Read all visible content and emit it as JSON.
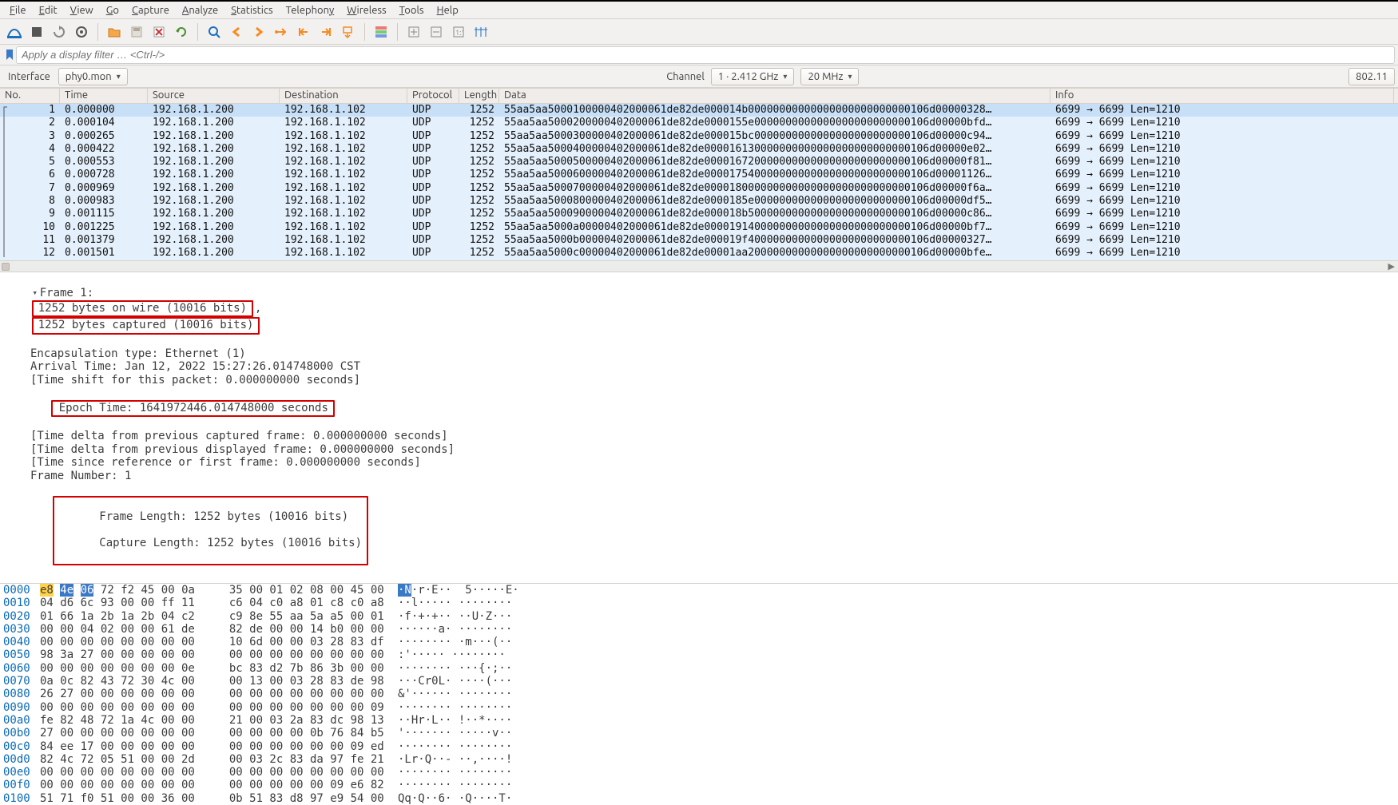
{
  "menu": {
    "items": [
      {
        "l": "F",
        "r": "ile"
      },
      {
        "l": "E",
        "r": "dit"
      },
      {
        "l": "V",
        "r": "iew"
      },
      {
        "l": "G",
        "r": "o"
      },
      {
        "l": "C",
        "r": "apture"
      },
      {
        "l": "A",
        "r": "nalyze"
      },
      {
        "l": "S",
        "r": "tatistics"
      },
      {
        "l": "",
        "r": "Telephon",
        "l2": "y"
      },
      {
        "l": "W",
        "r": "ireless"
      },
      {
        "l": "T",
        "r": "ools"
      },
      {
        "l": "H",
        "r": "elp"
      }
    ]
  },
  "filter": {
    "placeholder": "Apply a display filter … <Ctrl-/>"
  },
  "iface": {
    "label": "Interface",
    "value": "phy0.mon",
    "channel_label": "Channel",
    "channel_value": "1 · 2.412 GHz",
    "bw_value": "20 MHz",
    "std": "802.11"
  },
  "columns": [
    "No.",
    "Time",
    "Source",
    "Destination",
    "Protocol",
    "Length",
    "Data",
    "Info"
  ],
  "packets": [
    {
      "no": "1",
      "time": "0.000000",
      "src": "192.168.1.200",
      "dst": "192.168.1.102",
      "proto": "UDP",
      "len": "1252",
      "data": "55aa5aa5000100000402000061de82de000014b00000000000000000000000000106d00000328…",
      "info": "6699 → 6699  Len=1210",
      "sel": true
    },
    {
      "no": "2",
      "time": "0.000104",
      "src": "192.168.1.200",
      "dst": "192.168.1.102",
      "proto": "UDP",
      "len": "1252",
      "data": "55aa5aa5000200000402000061de82de0000155e0000000000000000000000000106d00000bfd…",
      "info": "6699 → 6699  Len=1210"
    },
    {
      "no": "3",
      "time": "0.000265",
      "src": "192.168.1.200",
      "dst": "192.168.1.102",
      "proto": "UDP",
      "len": "1252",
      "data": "55aa5aa5000300000402000061de82de000015bc0000000000000000000000000106d00000c94…",
      "info": "6699 → 6699  Len=1210"
    },
    {
      "no": "4",
      "time": "0.000422",
      "src": "192.168.1.200",
      "dst": "192.168.1.102",
      "proto": "UDP",
      "len": "1252",
      "data": "55aa5aa5000400000402000061de82de000016130000000000000000000000000106d00000e02…",
      "info": "6699 → 6699  Len=1210"
    },
    {
      "no": "5",
      "time": "0.000553",
      "src": "192.168.1.200",
      "dst": "192.168.1.102",
      "proto": "UDP",
      "len": "1252",
      "data": "55aa5aa5000500000402000061de82de000016720000000000000000000000000106d00000f81…",
      "info": "6699 → 6699  Len=1210"
    },
    {
      "no": "6",
      "time": "0.000728",
      "src": "192.168.1.200",
      "dst": "192.168.1.102",
      "proto": "UDP",
      "len": "1252",
      "data": "55aa5aa5000600000402000061de82de000017540000000000000000000000000106d00001126…",
      "info": "6699 → 6699  Len=1210"
    },
    {
      "no": "7",
      "time": "0.000969",
      "src": "192.168.1.200",
      "dst": "192.168.1.102",
      "proto": "UDP",
      "len": "1252",
      "data": "55aa5aa5000700000402000061de82de000018000000000000000000000000000106d00000f6a…",
      "info": "6699 → 6699  Len=1210"
    },
    {
      "no": "8",
      "time": "0.000983",
      "src": "192.168.1.200",
      "dst": "192.168.1.102",
      "proto": "UDP",
      "len": "1252",
      "data": "55aa5aa5000800000402000061de82de0000185e0000000000000000000000000106d00000df5…",
      "info": "6699 → 6699  Len=1210"
    },
    {
      "no": "9",
      "time": "0.001115",
      "src": "192.168.1.200",
      "dst": "192.168.1.102",
      "proto": "UDP",
      "len": "1252",
      "data": "55aa5aa5000900000402000061de82de000018b50000000000000000000000000106d00000c86…",
      "info": "6699 → 6699  Len=1210"
    },
    {
      "no": "10",
      "time": "0.001225",
      "src": "192.168.1.200",
      "dst": "192.168.1.102",
      "proto": "UDP",
      "len": "1252",
      "data": "55aa5aa5000a00000402000061de82de000019140000000000000000000000000106d00000bf7…",
      "info": "6699 → 6699  Len=1210"
    },
    {
      "no": "11",
      "time": "0.001379",
      "src": "192.168.1.200",
      "dst": "192.168.1.102",
      "proto": "UDP",
      "len": "1252",
      "data": "55aa5aa5000b00000402000061de82de000019f40000000000000000000000000106d00000327…",
      "info": "6699 → 6699  Len=1210"
    },
    {
      "no": "12",
      "time": "0.001501",
      "src": "192.168.1.200",
      "dst": "192.168.1.102",
      "proto": "UDP",
      "len": "1252",
      "data": "55aa5aa5000c00000402000061de82de00001aa20000000000000000000000000106d00000bfe…",
      "info": "6699 → 6699  Len=1210"
    }
  ],
  "detail": {
    "frame_label": "Frame 1:",
    "onwire": "1252 bytes on wire (10016 bits)",
    "captured": "1252 bytes captured (10016 bits)",
    "encap": "Encapsulation type: Ethernet (1)",
    "arrival": "Arrival Time: Jan 12, 2022 15:27:26.014748000 CST",
    "timeshift": "[Time shift for this packet: 0.000000000 seconds]",
    "epoch": "Epoch Time: 1641972446.014748000 seconds",
    "delta_cap": "[Time delta from previous captured frame: 0.000000000 seconds]",
    "delta_disp": "[Time delta from previous displayed frame: 0.000000000 seconds]",
    "since_ref": "[Time since reference or first frame: 0.000000000 seconds]",
    "frame_no": "Frame Number: 1",
    "frame_len": "Frame Length: 1252 bytes (10016 bits)",
    "cap_len": "Capture Length: 1252 bytes (10016 bits)"
  },
  "hex": [
    {
      "off": "0000",
      "b1": "e8 4e 06 72 f2 45 00 0a",
      "b2": "  35 00 01 02 08 00 45 00",
      "a": "·N·r·E··  5·····E·",
      "hl": [
        0,
        1,
        2
      ]
    },
    {
      "off": "0010",
      "b1": "04 d6 6c 93 00 00 ff 11",
      "b2": "  c6 04 c0 a8 01 c8 c0 a8",
      "a": "··l····· ········"
    },
    {
      "off": "0020",
      "b1": "01 66 1a 2b 1a 2b 04 c2",
      "b2": "  c9 8e 55 aa 5a a5 00 01",
      "a": "·f·+·+·· ··U·Z···"
    },
    {
      "off": "0030",
      "b1": "00 00 04 02 00 00 61 de",
      "b2": "  82 de 00 00 14 b0 00 00",
      "a": "······a· ········"
    },
    {
      "off": "0040",
      "b1": "00 00 00 00 00 00 00 00",
      "b2": "  10 6d 00 00 03 28 83 df",
      "a": "········ ·m···(··"
    },
    {
      "off": "0050",
      "b1": "98 3a 27 00 00 00 00 00",
      "b2": "  00 00 00 00 00 00 00 00",
      "a": ":'····· ········"
    },
    {
      "off": "0060",
      "b1": "00 00 00 00 00 00 00 0e",
      "b2": "  bc 83 d2 7b 86 3b 00 00",
      "a": "········ ···{·;··"
    },
    {
      "off": "0070",
      "b1": "0a 0c 82 43 72 30 4c 00",
      "b2": "  00 13 00 03 28 83 de 98",
      "a": "···Cr0L· ····(···"
    },
    {
      "off": "0080",
      "b1": "26 27 00 00 00 00 00 00",
      "b2": "  00 00 00 00 00 00 00 00",
      "a": "&'······ ········"
    },
    {
      "off": "0090",
      "b1": "00 00 00 00 00 00 00 00",
      "b2": "  00 00 00 00 00 00 00 09",
      "a": "········ ········"
    },
    {
      "off": "00a0",
      "b1": "fe 82 48 72 1a 4c 00 00",
      "b2": "  21 00 03 2a 83 dc 98 13",
      "a": "··Hr·L·· !··*····"
    },
    {
      "off": "00b0",
      "b1": "27 00 00 00 00 00 00 00",
      "b2": "  00 00 00 00 0b 76 84 b5",
      "a": "'······· ·····v··"
    },
    {
      "off": "00c0",
      "b1": "84 ee 17 00 00 00 00 00",
      "b2": "  00 00 00 00 00 00 09 ed",
      "a": "········ ········"
    },
    {
      "off": "00d0",
      "b1": "82 4c 72 05 51 00 00 2d",
      "b2": "  00 03 2c 83 da 97 fe 21",
      "a": "·Lr·Q··- ··,····!"
    },
    {
      "off": "00e0",
      "b1": "00 00 00 00 00 00 00 00",
      "b2": "  00 00 00 00 00 00 00 00",
      "a": "········ ········"
    },
    {
      "off": "00f0",
      "b1": "00 00 00 00 00 00 00 00",
      "b2": "  00 00 00 00 00 09 e6 82",
      "a": "········ ········"
    },
    {
      "off": "0100",
      "b1": "51 71 f0 51 00 00 36 00",
      "b2": "  0b 51 83 d8 97 e9 54 00",
      "a": "Qq·Q··6· ·Q····T·"
    }
  ]
}
